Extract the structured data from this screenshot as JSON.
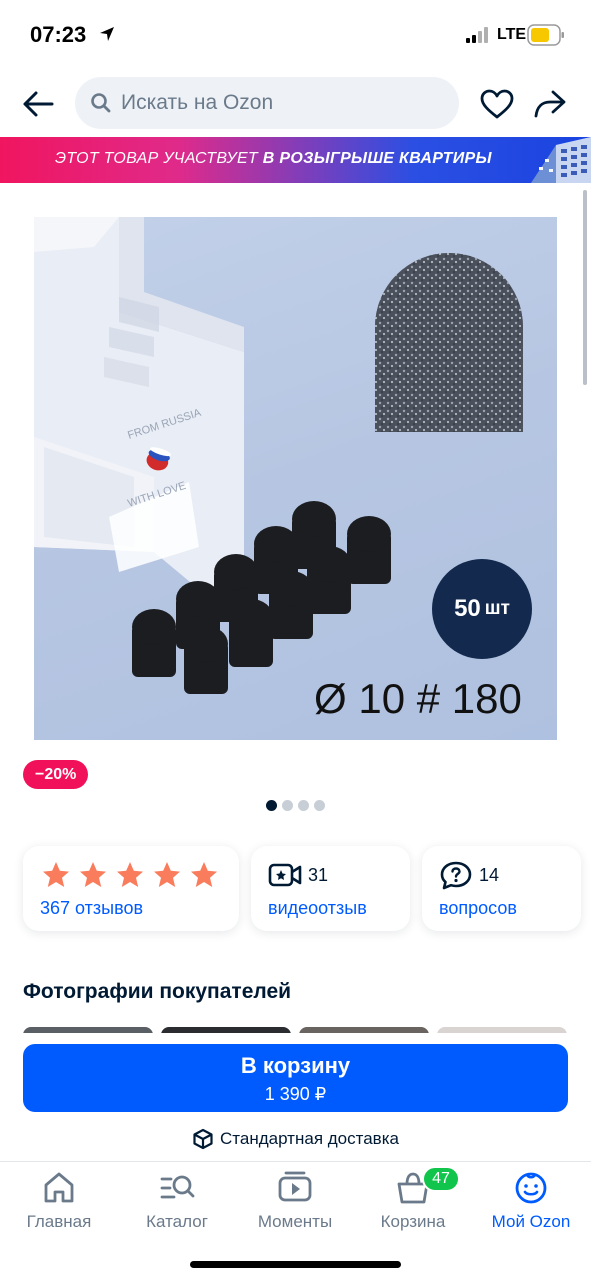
{
  "status_bar": {
    "time": "07:23",
    "network": "LTE"
  },
  "header": {
    "search_placeholder": "Искать на Ozon"
  },
  "promo": {
    "text_regular": "ЭТОТ ТОВАР УЧАСТВУЕТ ",
    "text_bold": "В РОЗЫГРЫШЕ КВАРТИРЫ"
  },
  "product": {
    "image_quantity_value": "50",
    "image_quantity_unit": "шт",
    "image_spec_text": "Ø 10 # 180",
    "box_text_1": "FROM RUSSIA",
    "box_text_2": "WITH LOVE",
    "discount": "−20%",
    "gallery_dots": 4,
    "gallery_active_index": 0
  },
  "stats": {
    "rating_stars": 5,
    "reviews_label": "367 отзывов",
    "video_count": "31",
    "video_label": "видеоотзыв",
    "questions_count": "14",
    "questions_label": "вопросов"
  },
  "customer_photos": {
    "title": "Фотографии покупателей"
  },
  "purchase": {
    "button_label": "В корзину",
    "price": "1 390 ₽",
    "delivery_label": "Стандартная доставка"
  },
  "tabbar": {
    "items": [
      {
        "label": "Главная",
        "icon": "home-icon"
      },
      {
        "label": "Каталог",
        "icon": "catalog-search-icon"
      },
      {
        "label": "Моменты",
        "icon": "moments-play-icon"
      },
      {
        "label": "Корзина",
        "icon": "cart-bag-icon",
        "badge": "47"
      },
      {
        "label": "Мой Ozon",
        "icon": "smile-account-icon",
        "active": true
      }
    ]
  },
  "colors": {
    "accent": "#005bff",
    "discount": "#f1115a",
    "star": "#f97c5c",
    "badge_green": "#10c44c",
    "text": "#001a34"
  }
}
